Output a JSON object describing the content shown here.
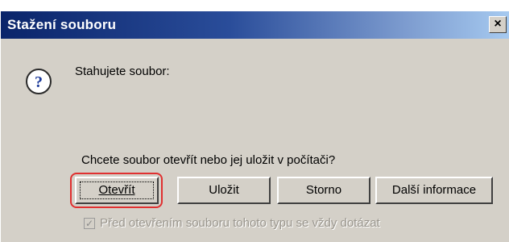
{
  "dialog": {
    "title": "Stažení souboru",
    "close_label": "×",
    "prompt": "Stahujete soubor:",
    "question": "Chcete soubor otevřít nebo jej uložit v počítači?",
    "icon": "question-icon"
  },
  "buttons": {
    "open": "Otevřít",
    "save": "Uložit",
    "cancel": "Storno",
    "more": "Další informace"
  },
  "checkbox": {
    "label": "Před otevřením souboru tohoto typu se vždy dotázat",
    "checked": true,
    "disabled": true
  },
  "colors": {
    "titlebar_start": "#0a246a",
    "titlebar_end": "#a6caf0",
    "dialog_bg": "#d4d0c8",
    "highlight": "#e03030"
  }
}
